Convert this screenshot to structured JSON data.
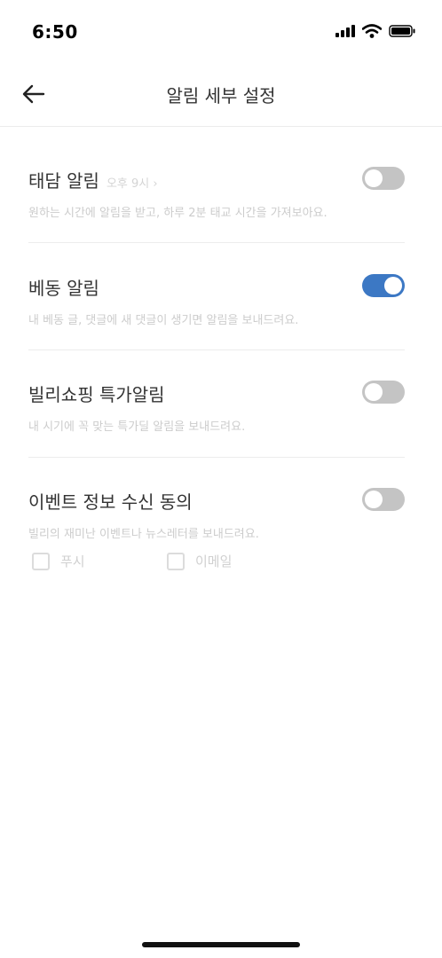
{
  "status_bar": {
    "time": "6:50"
  },
  "nav": {
    "title": "알림 세부 설정"
  },
  "sections": [
    {
      "title": "태담 알림",
      "extra": "오후 9시 ›",
      "description": "원하는 시간에 알림을 받고, 하루 2분 태교 시간을 가져보아요.",
      "enabled": false
    },
    {
      "title": "베동 알림",
      "description": "내 베동 글, 댓글에 새 댓글이 생기면 알림을 보내드려요.",
      "enabled": true
    },
    {
      "title": "빌리쇼핑 특가알림",
      "description": "내 시기에 꼭 맞는 특가딜 알림을 보내드려요.",
      "enabled": false
    },
    {
      "title": "이벤트 정보 수신 동의",
      "description": "빌리의 재미난 이벤트나 뉴스레터를 보내드려요.",
      "enabled": false
    }
  ],
  "event_channels": [
    {
      "label": "푸시",
      "checked": false
    },
    {
      "label": "이메일",
      "checked": false
    }
  ],
  "colors": {
    "toggle_on": "#3c78c4",
    "toggle_off": "#c4c4c4"
  }
}
